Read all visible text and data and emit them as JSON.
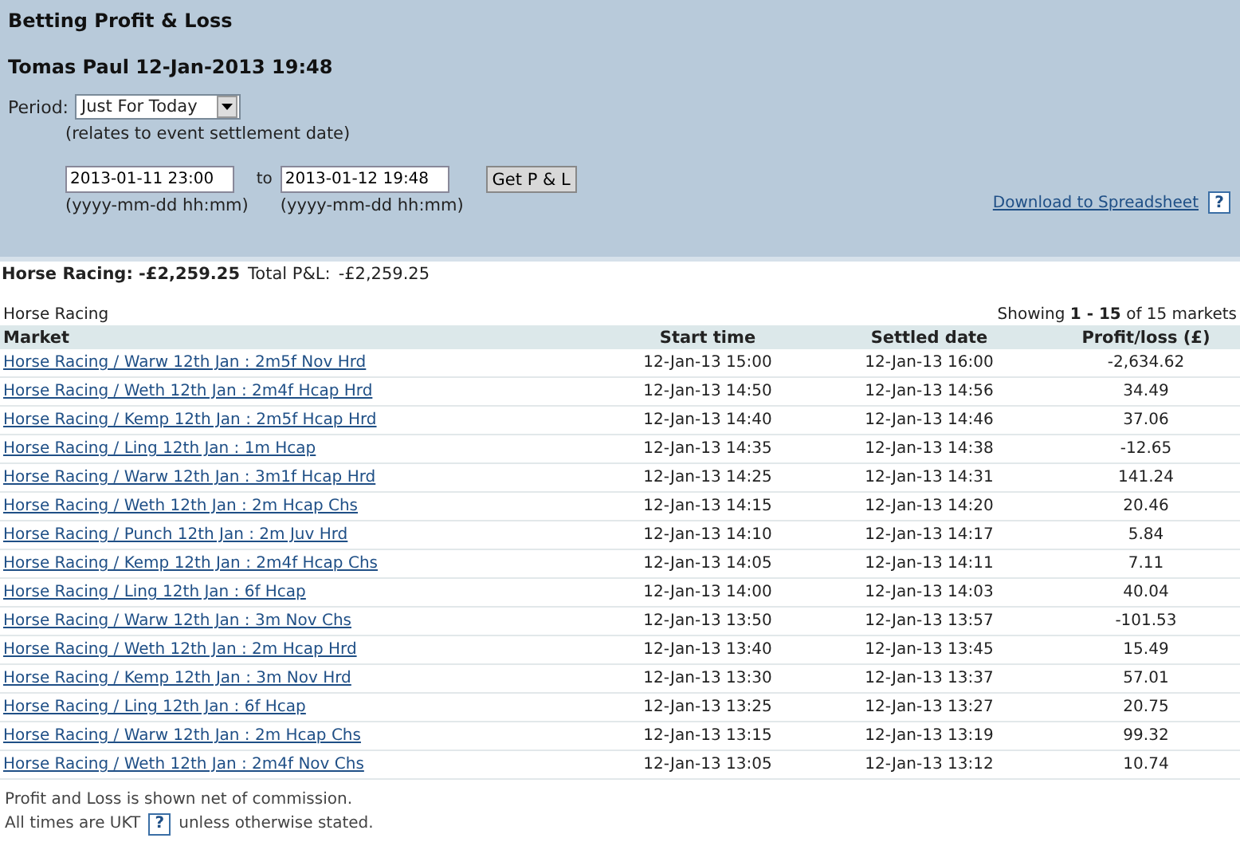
{
  "header": {
    "title": "Betting Profit & Loss",
    "subtitle": "Tomas Paul 12-Jan-2013 19:48",
    "period": {
      "label": "Period:",
      "value": "Just For Today",
      "note": "(relates to event settlement date)"
    },
    "from": {
      "value": "2013-01-11 23:00",
      "hint": "(yyyy-mm-dd hh:mm)"
    },
    "to_label": "to",
    "to": {
      "value": "2013-01-12 19:48",
      "hint": "(yyyy-mm-dd hh:mm)"
    },
    "button": "Get P & L",
    "download": "Download to Spreadsheet",
    "download_help": "?"
  },
  "summary": {
    "sport": "Horse Racing: -£2,259.25",
    "total_label": "Total P&L:",
    "total": "-£2,259.25"
  },
  "section": {
    "title": "Horse Racing",
    "showing": "Showing **1 - 15** of 15 markets"
  },
  "table": {
    "columns": [
      "Market",
      "Start time",
      "Settled date",
      "Profit/loss (£)"
    ],
    "rows": [
      [
        "Horse Racing / Warw 12th Jan : 2m5f Nov Hrd",
        "12-Jan-13 15:00",
        "12-Jan-13 16:00",
        "-2,634.62"
      ],
      [
        "Horse Racing / Weth 12th Jan : 2m4f Hcap Hrd",
        "12-Jan-13 14:50",
        "12-Jan-13 14:56",
        "34.49"
      ],
      [
        "Horse Racing / Kemp 12th Jan : 2m5f Hcap Hrd",
        "12-Jan-13 14:40",
        "12-Jan-13 14:46",
        "37.06"
      ],
      [
        "Horse Racing / Ling 12th Jan : 1m Hcap",
        "12-Jan-13 14:35",
        "12-Jan-13 14:38",
        "-12.65"
      ],
      [
        "Horse Racing / Warw 12th Jan : 3m1f Hcap Hrd",
        "12-Jan-13 14:25",
        "12-Jan-13 14:31",
        "141.24"
      ],
      [
        "Horse Racing / Weth 12th Jan : 2m Hcap Chs",
        "12-Jan-13 14:15",
        "12-Jan-13 14:20",
        "20.46"
      ],
      [
        "Horse Racing / Punch 12th Jan : 2m Juv Hrd",
        "12-Jan-13 14:10",
        "12-Jan-13 14:17",
        "5.84"
      ],
      [
        "Horse Racing / Kemp 12th Jan : 2m4f Hcap Chs",
        "12-Jan-13 14:05",
        "12-Jan-13 14:11",
        "7.11"
      ],
      [
        "Horse Racing / Ling 12th Jan : 6f Hcap",
        "12-Jan-13 14:00",
        "12-Jan-13 14:03",
        "40.04"
      ],
      [
        "Horse Racing / Warw 12th Jan : 3m Nov Chs",
        "12-Jan-13 13:50",
        "12-Jan-13 13:57",
        "-101.53"
      ],
      [
        "Horse Racing / Weth 12th Jan : 2m Hcap Hrd",
        "12-Jan-13 13:40",
        "12-Jan-13 13:45",
        "15.49"
      ],
      [
        "Horse Racing / Kemp 12th Jan : 3m Nov Hrd",
        "12-Jan-13 13:30",
        "12-Jan-13 13:37",
        "57.01"
      ],
      [
        "Horse Racing / Ling 12th Jan : 6f Hcap",
        "12-Jan-13 13:25",
        "12-Jan-13 13:27",
        "20.75"
      ],
      [
        "Horse Racing / Warw 12th Jan : 2m Hcap Chs",
        "12-Jan-13 13:15",
        "12-Jan-13 13:19",
        "99.32"
      ],
      [
        "Horse Racing / Weth 12th Jan : 2m4f Nov Chs",
        "12-Jan-13 13:05",
        "12-Jan-13 13:12",
        "10.74"
      ]
    ]
  },
  "footer": {
    "line1": "Profit and Loss is shown net of commission.",
    "line2_start": "All times are UKT",
    "line2_help": "?",
    "line2_end": "unless otherwise stated."
  }
}
